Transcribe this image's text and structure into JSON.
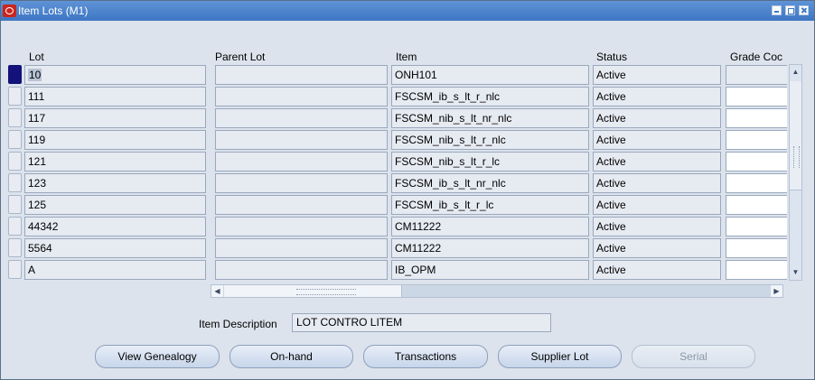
{
  "window": {
    "title": "Item Lots (M1)"
  },
  "columns": {
    "lot": "Lot",
    "parent_lot": "Parent Lot",
    "item": "Item",
    "status": "Status",
    "grade": "Grade Coc"
  },
  "rows": [
    {
      "lot": "10",
      "parent_lot": "",
      "item": "ONH101",
      "status": "Active",
      "grade": ""
    },
    {
      "lot": "111",
      "parent_lot": "",
      "item": "FSCSM_ib_s_lt_r_nlc",
      "status": "Active",
      "grade": ""
    },
    {
      "lot": "117",
      "parent_lot": "",
      "item": "FSCSM_nib_s_lt_nr_nlc",
      "status": "Active",
      "grade": ""
    },
    {
      "lot": "119",
      "parent_lot": "",
      "item": "FSCSM_nib_s_lt_r_nlc",
      "status": "Active",
      "grade": ""
    },
    {
      "lot": "121",
      "parent_lot": "",
      "item": "FSCSM_nib_s_lt_r_lc",
      "status": "Active",
      "grade": ""
    },
    {
      "lot": "123",
      "parent_lot": "",
      "item": "FSCSM_ib_s_lt_nr_nlc",
      "status": "Active",
      "grade": ""
    },
    {
      "lot": "125",
      "parent_lot": "",
      "item": "FSCSM_ib_s_lt_r_lc",
      "status": "Active",
      "grade": ""
    },
    {
      "lot": "44342",
      "parent_lot": "",
      "item": "CM11222",
      "status": "Active",
      "grade": ""
    },
    {
      "lot": "5564",
      "parent_lot": "",
      "item": "CM11222",
      "status": "Active",
      "grade": ""
    },
    {
      "lot": "A",
      "parent_lot": "",
      "item": "IB_OPM",
      "status": "Active",
      "grade": ""
    }
  ],
  "item_description": {
    "label": "Item Description",
    "value": "LOT CONTRO LITEM"
  },
  "buttons": {
    "view_genealogy": "View Genealogy",
    "on_hand": "On-hand",
    "transactions": "Transactions",
    "supplier_lot": "Supplier Lot",
    "serial": "Serial"
  },
  "colors": {
    "title_bar": "#3d76c4",
    "current_record_indicator": "#12127a"
  }
}
